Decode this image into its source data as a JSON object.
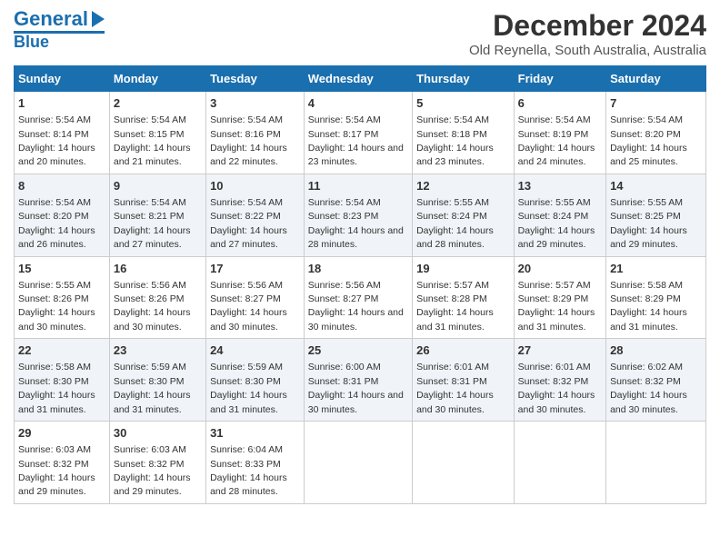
{
  "logo": {
    "line1": "General",
    "line2": "Blue"
  },
  "title": "December 2024",
  "subtitle": "Old Reynella, South Australia, Australia",
  "weekdays": [
    "Sunday",
    "Monday",
    "Tuesday",
    "Wednesday",
    "Thursday",
    "Friday",
    "Saturday"
  ],
  "weeks": [
    [
      {
        "day": "1",
        "sunrise": "Sunrise: 5:54 AM",
        "sunset": "Sunset: 8:14 PM",
        "daylight": "Daylight: 14 hours and 20 minutes."
      },
      {
        "day": "2",
        "sunrise": "Sunrise: 5:54 AM",
        "sunset": "Sunset: 8:15 PM",
        "daylight": "Daylight: 14 hours and 21 minutes."
      },
      {
        "day": "3",
        "sunrise": "Sunrise: 5:54 AM",
        "sunset": "Sunset: 8:16 PM",
        "daylight": "Daylight: 14 hours and 22 minutes."
      },
      {
        "day": "4",
        "sunrise": "Sunrise: 5:54 AM",
        "sunset": "Sunset: 8:17 PM",
        "daylight": "Daylight: 14 hours and 23 minutes."
      },
      {
        "day": "5",
        "sunrise": "Sunrise: 5:54 AM",
        "sunset": "Sunset: 8:18 PM",
        "daylight": "Daylight: 14 hours and 23 minutes."
      },
      {
        "day": "6",
        "sunrise": "Sunrise: 5:54 AM",
        "sunset": "Sunset: 8:19 PM",
        "daylight": "Daylight: 14 hours and 24 minutes."
      },
      {
        "day": "7",
        "sunrise": "Sunrise: 5:54 AM",
        "sunset": "Sunset: 8:20 PM",
        "daylight": "Daylight: 14 hours and 25 minutes."
      }
    ],
    [
      {
        "day": "8",
        "sunrise": "Sunrise: 5:54 AM",
        "sunset": "Sunset: 8:20 PM",
        "daylight": "Daylight: 14 hours and 26 minutes."
      },
      {
        "day": "9",
        "sunrise": "Sunrise: 5:54 AM",
        "sunset": "Sunset: 8:21 PM",
        "daylight": "Daylight: 14 hours and 27 minutes."
      },
      {
        "day": "10",
        "sunrise": "Sunrise: 5:54 AM",
        "sunset": "Sunset: 8:22 PM",
        "daylight": "Daylight: 14 hours and 27 minutes."
      },
      {
        "day": "11",
        "sunrise": "Sunrise: 5:54 AM",
        "sunset": "Sunset: 8:23 PM",
        "daylight": "Daylight: 14 hours and 28 minutes."
      },
      {
        "day": "12",
        "sunrise": "Sunrise: 5:55 AM",
        "sunset": "Sunset: 8:24 PM",
        "daylight": "Daylight: 14 hours and 28 minutes."
      },
      {
        "day": "13",
        "sunrise": "Sunrise: 5:55 AM",
        "sunset": "Sunset: 8:24 PM",
        "daylight": "Daylight: 14 hours and 29 minutes."
      },
      {
        "day": "14",
        "sunrise": "Sunrise: 5:55 AM",
        "sunset": "Sunset: 8:25 PM",
        "daylight": "Daylight: 14 hours and 29 minutes."
      }
    ],
    [
      {
        "day": "15",
        "sunrise": "Sunrise: 5:55 AM",
        "sunset": "Sunset: 8:26 PM",
        "daylight": "Daylight: 14 hours and 30 minutes."
      },
      {
        "day": "16",
        "sunrise": "Sunrise: 5:56 AM",
        "sunset": "Sunset: 8:26 PM",
        "daylight": "Daylight: 14 hours and 30 minutes."
      },
      {
        "day": "17",
        "sunrise": "Sunrise: 5:56 AM",
        "sunset": "Sunset: 8:27 PM",
        "daylight": "Daylight: 14 hours and 30 minutes."
      },
      {
        "day": "18",
        "sunrise": "Sunrise: 5:56 AM",
        "sunset": "Sunset: 8:27 PM",
        "daylight": "Daylight: 14 hours and 30 minutes."
      },
      {
        "day": "19",
        "sunrise": "Sunrise: 5:57 AM",
        "sunset": "Sunset: 8:28 PM",
        "daylight": "Daylight: 14 hours and 31 minutes."
      },
      {
        "day": "20",
        "sunrise": "Sunrise: 5:57 AM",
        "sunset": "Sunset: 8:29 PM",
        "daylight": "Daylight: 14 hours and 31 minutes."
      },
      {
        "day": "21",
        "sunrise": "Sunrise: 5:58 AM",
        "sunset": "Sunset: 8:29 PM",
        "daylight": "Daylight: 14 hours and 31 minutes."
      }
    ],
    [
      {
        "day": "22",
        "sunrise": "Sunrise: 5:58 AM",
        "sunset": "Sunset: 8:30 PM",
        "daylight": "Daylight: 14 hours and 31 minutes."
      },
      {
        "day": "23",
        "sunrise": "Sunrise: 5:59 AM",
        "sunset": "Sunset: 8:30 PM",
        "daylight": "Daylight: 14 hours and 31 minutes."
      },
      {
        "day": "24",
        "sunrise": "Sunrise: 5:59 AM",
        "sunset": "Sunset: 8:30 PM",
        "daylight": "Daylight: 14 hours and 31 minutes."
      },
      {
        "day": "25",
        "sunrise": "Sunrise: 6:00 AM",
        "sunset": "Sunset: 8:31 PM",
        "daylight": "Daylight: 14 hours and 30 minutes."
      },
      {
        "day": "26",
        "sunrise": "Sunrise: 6:01 AM",
        "sunset": "Sunset: 8:31 PM",
        "daylight": "Daylight: 14 hours and 30 minutes."
      },
      {
        "day": "27",
        "sunrise": "Sunrise: 6:01 AM",
        "sunset": "Sunset: 8:32 PM",
        "daylight": "Daylight: 14 hours and 30 minutes."
      },
      {
        "day": "28",
        "sunrise": "Sunrise: 6:02 AM",
        "sunset": "Sunset: 8:32 PM",
        "daylight": "Daylight: 14 hours and 30 minutes."
      }
    ],
    [
      {
        "day": "29",
        "sunrise": "Sunrise: 6:03 AM",
        "sunset": "Sunset: 8:32 PM",
        "daylight": "Daylight: 14 hours and 29 minutes."
      },
      {
        "day": "30",
        "sunrise": "Sunrise: 6:03 AM",
        "sunset": "Sunset: 8:32 PM",
        "daylight": "Daylight: 14 hours and 29 minutes."
      },
      {
        "day": "31",
        "sunrise": "Sunrise: 6:04 AM",
        "sunset": "Sunset: 8:33 PM",
        "daylight": "Daylight: 14 hours and 28 minutes."
      },
      {
        "day": "",
        "sunrise": "",
        "sunset": "",
        "daylight": ""
      },
      {
        "day": "",
        "sunrise": "",
        "sunset": "",
        "daylight": ""
      },
      {
        "day": "",
        "sunrise": "",
        "sunset": "",
        "daylight": ""
      },
      {
        "day": "",
        "sunrise": "",
        "sunset": "",
        "daylight": ""
      }
    ]
  ]
}
